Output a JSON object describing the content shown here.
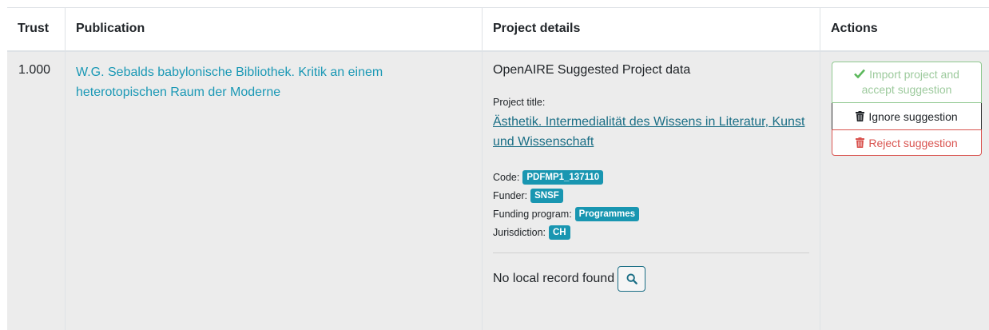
{
  "table": {
    "headers": [
      "Trust",
      "Publication",
      "Project details",
      "Actions"
    ]
  },
  "row": {
    "trust": "1.000",
    "publication": "W.G. Sebalds babylonische Bibliothek. Kritik an einem heterotopischen Raum der Moderne",
    "project": {
      "heading": "OpenAIRE Suggested Project data",
      "title_label": "Project title:",
      "title": "Ästhetik. Intermedialität des Wissens in Literatur, Kunst und Wissenschaft",
      "code_label": "Code:",
      "code": "PDFMP1_137110",
      "funder_label": "Funder:",
      "funder": "SNSF",
      "program_label": "Funding program:",
      "program": "Programmes",
      "jurisdiction_label": "Jurisdiction:",
      "jurisdiction": "CH",
      "no_local": "No local record found"
    },
    "actions": {
      "import": "Import project and accept suggestion",
      "ignore": "Ignore suggestion",
      "reject": "Reject suggestion"
    }
  },
  "colors": {
    "link": "#1a98b5",
    "badge": "#1996b1",
    "success": "#8fc88f",
    "danger": "#d9534f",
    "row_bg": "#ececec"
  },
  "icons": {
    "import": "check-icon",
    "ignore": "trash-icon",
    "reject": "trash-icon",
    "search": "search-icon"
  }
}
